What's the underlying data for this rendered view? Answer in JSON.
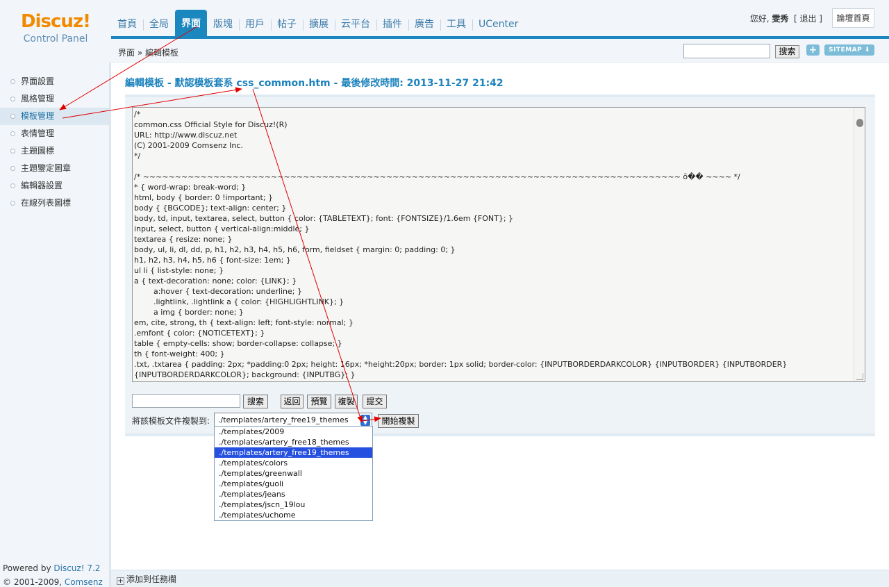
{
  "logo": {
    "brand": "Discuz!",
    "subtitle": "Control Panel"
  },
  "nav": {
    "items": [
      {
        "label": "首頁"
      },
      {
        "label": "全局"
      },
      {
        "label": "界面"
      },
      {
        "label": "版塊"
      },
      {
        "label": "用戶"
      },
      {
        "label": "帖子"
      },
      {
        "label": "擴展"
      },
      {
        "label": "云平台"
      },
      {
        "label": "插件"
      },
      {
        "label": "廣告"
      },
      {
        "label": "工具"
      },
      {
        "label": "UCenter"
      }
    ],
    "active_index": 2
  },
  "user": {
    "greeting": "您好,",
    "name": "雯秀",
    "logout": "[ 退出 ]",
    "home_button": "論壇首頁"
  },
  "subbar": {
    "breadcrumb": "界面 » 編輯模板",
    "search_button": "搜索",
    "plus": "+",
    "sitemap": "SITEMAP ⬇"
  },
  "sidebar": {
    "items": [
      {
        "label": "界面設置"
      },
      {
        "label": "風格管理"
      },
      {
        "label": "模板管理"
      },
      {
        "label": "表情管理"
      },
      {
        "label": "主題圖標"
      },
      {
        "label": "主題鑒定圖章"
      },
      {
        "label": "編輯器設置"
      },
      {
        "label": "在線列表圖標"
      }
    ],
    "active_index": 2,
    "powered_prefix": "Powered by ",
    "powered_link": "Discuz! 7.2",
    "copyright_prefix": "© 2001-2009, ",
    "copyright_link": "Comsenz Inc."
  },
  "main": {
    "title": "編輯模板 - 默認模板套系 css_common.htm - 最後修改時間: 2013-11-27 21:42",
    "code": "/*\ncommon.css Official Style for Discuz!(R)\nURL: http://www.discuz.net\n(C) 2001-2009 Comsenz Inc.\n*/\n\n/* ~~~~~~~~~~~~~~~~~~~~~~~~~~~~~~~~~~~~~~~~~~~~~~~~~~~~~~~~~~~~~~~~~~~~~~~~~~~~~~~~~~~~ ȏ�� ~~~~ */\n* { word-wrap: break-word; }\nhtml, body { border: 0 !important; }\nbody { {BGCODE}; text-align: center; }\nbody, td, input, textarea, select, button { color: {TABLETEXT}; font: {FONTSIZE}/1.6em {FONT}; }\ninput, select, button { vertical-align:middle; }\ntextarea { resize: none; }\nbody, ul, li, dl, dd, p, h1, h2, h3, h4, h5, h6, form, fieldset { margin: 0; padding: 0; }\nh1, h2, h3, h4, h5, h6 { font-size: 1em; }\nul li { list-style: none; }\na { text-decoration: none; color: {LINK}; }\n        a:hover { text-decoration: underline; }\n        .lightlink, .lightlink a { color: {HIGHLIGHTLINK}; }\n        a img { border: none; }\nem, cite, strong, th { text-align: left; font-style: normal; }\n.emfont { color: {NOTICETEXT}; }\ntable { empty-cells: show; border-collapse: collapse; }\nth { font-weight: 400; }\n.txt, .txtarea { padding: 2px; *padding:0 2px; height: 16px; *height:20px; border: 1px solid; border-color: {INPUTBORDERDARKCOLOR} {INPUTBORDER} {INPUTBORDER} {INPUTBORDERDARKCOLOR}; background: {INPUTBG}; }",
    "buttons": {
      "search": "搜索",
      "back": "返回",
      "preview": "預覽",
      "copy": "複製",
      "submit": "提交"
    },
    "copy_label": "將該模板文件複製到:",
    "selected_option": "./templates/artery_free19_themes",
    "start_copy": "開始複製",
    "options": [
      "./templates/2009",
      "./templates/artery_free18_themes",
      "./templates/artery_free19_themes",
      "./templates/colors",
      "./templates/greenwall",
      "./templates/guoli",
      "./templates/jeans",
      "./templates/jscn_19lou",
      "./templates/uchome"
    ],
    "selected_index": 2
  },
  "bottom": {
    "add_task": "添加到任務欄"
  },
  "colors": {
    "accent": "#1b87bf",
    "logo": "#f28a00",
    "arrow": "#e00000"
  }
}
